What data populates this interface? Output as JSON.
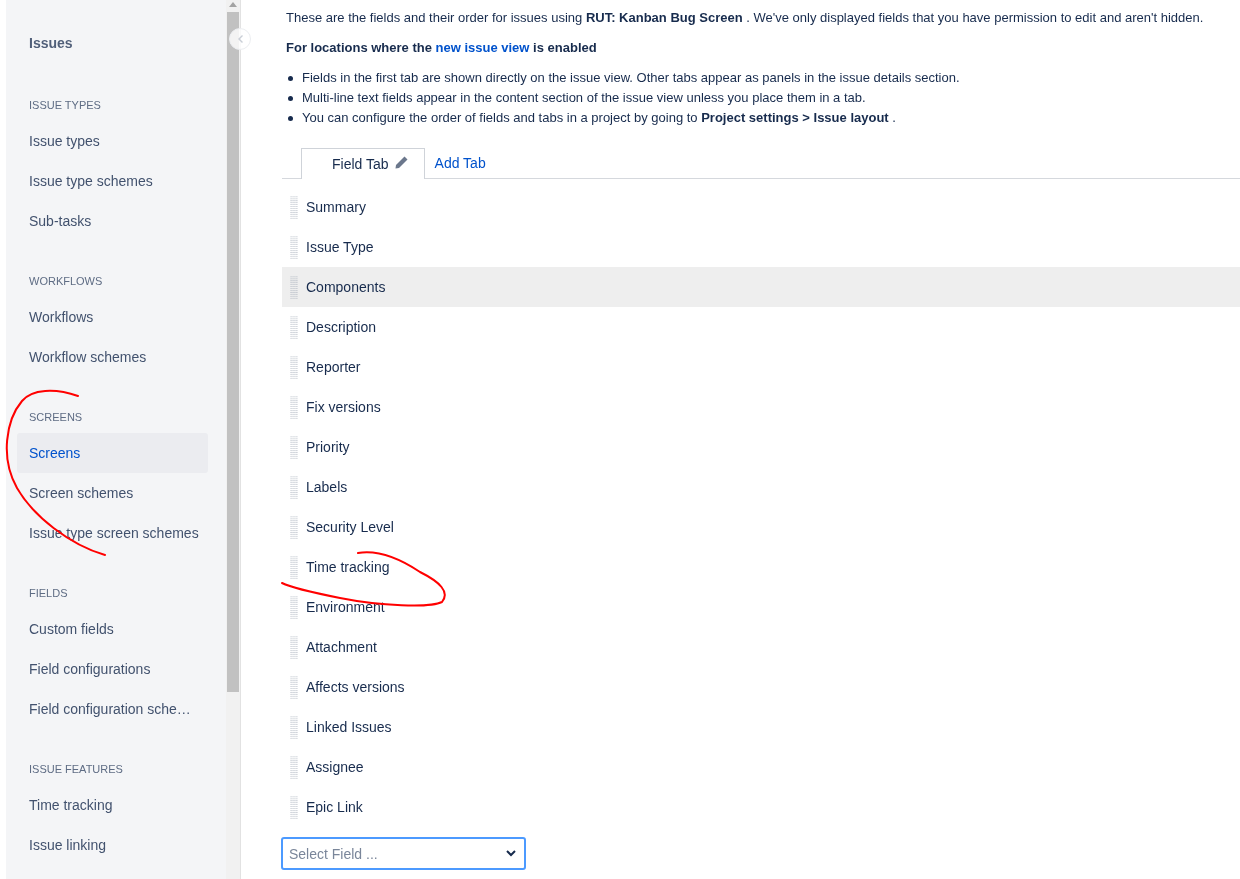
{
  "sidebar": {
    "title": "Issues",
    "sections": [
      {
        "heading": "ISSUE TYPES",
        "items": [
          {
            "label": "Issue types",
            "selected": false
          },
          {
            "label": "Issue type schemes",
            "selected": false
          },
          {
            "label": "Sub-tasks",
            "selected": false
          }
        ]
      },
      {
        "heading": "WORKFLOWS",
        "items": [
          {
            "label": "Workflows",
            "selected": false
          },
          {
            "label": "Workflow schemes",
            "selected": false
          }
        ]
      },
      {
        "heading": "SCREENS",
        "items": [
          {
            "label": "Screens",
            "selected": true
          },
          {
            "label": "Screen schemes",
            "selected": false
          },
          {
            "label": "Issue type screen schemes",
            "selected": false
          }
        ]
      },
      {
        "heading": "FIELDS",
        "items": [
          {
            "label": "Custom fields",
            "selected": false
          },
          {
            "label": "Field configurations",
            "selected": false
          },
          {
            "label": "Field configuration sche…",
            "selected": false
          }
        ]
      },
      {
        "heading": "ISSUE FEATURES",
        "items": [
          {
            "label": "Time tracking",
            "selected": false
          },
          {
            "label": "Issue linking",
            "selected": false
          }
        ]
      }
    ]
  },
  "intro": "These are the fields and their order for issues using **RUT: Kanban Bug Screen** . We've only displayed fields that you have permission to edit and aren't hidden.",
  "notice": {
    "text_before": "For locations where the",
    "link": "new issue view",
    "text_after": "is enabled"
  },
  "bullets": [
    "Fields in the first tab are shown directly on the issue view. Other tabs appear as panels in the issue details section.",
    "Multi-line text fields appear in the content section of the issue view unless you place them in a tab.",
    "You can configure the order of fields and tabs in a project by going to **Project settings > Issue layout** ."
  ],
  "tabs": [
    {
      "label": "Field Tab",
      "selected": true
    },
    {
      "label": "Add Tab",
      "selected": false
    }
  ],
  "fields": [
    {
      "label": "Summary",
      "hovered": false
    },
    {
      "label": "Issue Type",
      "hovered": false
    },
    {
      "label": "Components",
      "hovered": true
    },
    {
      "label": "Description",
      "hovered": false
    },
    {
      "label": "Reporter",
      "hovered": false
    },
    {
      "label": "Fix versions",
      "hovered": false
    },
    {
      "label": "Priority",
      "hovered": false
    },
    {
      "label": "Labels",
      "hovered": false
    },
    {
      "label": "Security Level",
      "hovered": false
    },
    {
      "label": "Time tracking",
      "hovered": false
    },
    {
      "label": "Environment",
      "hovered": false
    },
    {
      "label": "Attachment",
      "hovered": false
    },
    {
      "label": "Affects versions",
      "hovered": false
    },
    {
      "label": "Linked Issues",
      "hovered": false
    },
    {
      "label": "Assignee",
      "hovered": false
    },
    {
      "label": "Epic Link",
      "hovered": false
    }
  ],
  "select": {
    "placeholder": "Select Field ..."
  }
}
